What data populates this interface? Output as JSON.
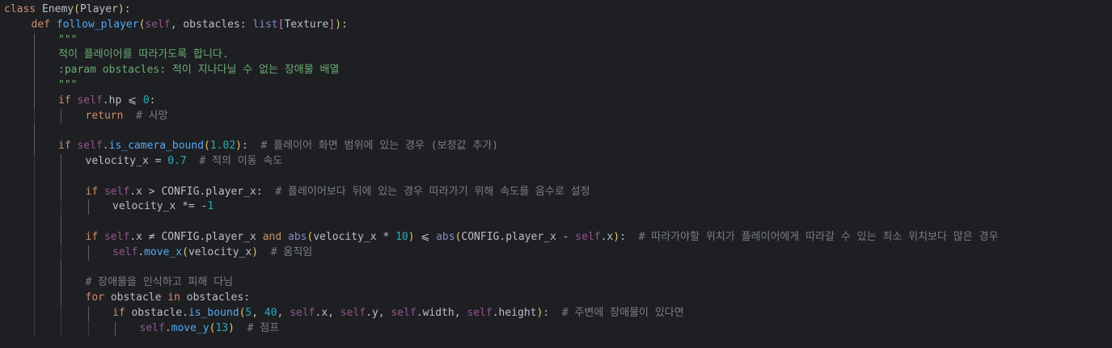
{
  "editor": {
    "language": "python",
    "background": "#1e1f22",
    "colors": {
      "keyword": "#cf8e6d",
      "function": "#56a8f5",
      "builtin": "#8888c6",
      "string": "#6aab73",
      "comment": "#7a7e85",
      "number": "#2aacb8",
      "class_ref": "#bcbec4",
      "self": "#94558d"
    },
    "lines": [
      {
        "indent": 0,
        "tokens": [
          [
            "kw",
            "class "
          ],
          [
            "cls",
            "Enemy"
          ],
          [
            "paren",
            "("
          ],
          [
            "cls",
            "Player"
          ],
          [
            "paren",
            "):"
          ]
        ]
      },
      {
        "indent": 1,
        "tokens": [
          [
            "kw",
            "def "
          ],
          [
            "fn",
            "follow_player"
          ],
          [
            "paren",
            "("
          ],
          [
            "self",
            "self"
          ],
          [
            "txt",
            ", obstacles: "
          ],
          [
            "builtin",
            "list"
          ],
          [
            "bracket",
            "["
          ],
          [
            "cls",
            "Texture"
          ],
          [
            "bracket",
            "]"
          ],
          [
            "paren",
            ")"
          ],
          [
            "txt",
            ":"
          ]
        ]
      },
      {
        "indent": 2,
        "tokens": [
          [
            "str",
            "\"\"\""
          ]
        ]
      },
      {
        "indent": 2,
        "tokens": [
          [
            "str",
            "적이 플레이어를 따라가도록 합니다."
          ]
        ]
      },
      {
        "indent": 2,
        "tokens": [
          [
            "str",
            ":param obstacles: 적이 지나다닐 수 없는 장애물 배열"
          ]
        ]
      },
      {
        "indent": 2,
        "tokens": [
          [
            "str",
            "\"\"\""
          ]
        ]
      },
      {
        "indent": 2,
        "tokens": [
          [
            "kw",
            "if "
          ],
          [
            "self",
            "self"
          ],
          [
            "txt",
            ".hp "
          ],
          [
            "txt",
            "⩽ "
          ],
          [
            "num",
            "0"
          ],
          [
            "txt",
            ":"
          ]
        ]
      },
      {
        "indent": 3,
        "tokens": [
          [
            "kw",
            "return"
          ],
          [
            "txt",
            "  "
          ],
          [
            "cmt",
            "# 사망"
          ]
        ]
      },
      {
        "indent": 0,
        "tokens": []
      },
      {
        "indent": 2,
        "tokens": [
          [
            "kw",
            "if "
          ],
          [
            "self",
            "self"
          ],
          [
            "txt",
            "."
          ],
          [
            "fn",
            "is_camera_bound"
          ],
          [
            "paren",
            "("
          ],
          [
            "num",
            "1.02"
          ],
          [
            "paren",
            ")"
          ],
          [
            "txt",
            ":  "
          ],
          [
            "cmt",
            "# 플레이어 화면 범위에 있는 경우 (보정값 추가)"
          ]
        ]
      },
      {
        "indent": 3,
        "tokens": [
          [
            "txt",
            "velocity_x = "
          ],
          [
            "num",
            "0.7"
          ],
          [
            "txt",
            "  "
          ],
          [
            "cmt",
            "# 적의 이동 속도"
          ]
        ]
      },
      {
        "indent": 0,
        "tokens": []
      },
      {
        "indent": 3,
        "tokens": [
          [
            "kw",
            "if "
          ],
          [
            "self",
            "self"
          ],
          [
            "txt",
            ".x > "
          ],
          [
            "cls",
            "CONFIG"
          ],
          [
            "txt",
            ".player_x:  "
          ],
          [
            "cmt",
            "# 플레이어보다 뒤에 있는 경우 따라가기 위해 속도를 음수로 설정"
          ]
        ]
      },
      {
        "indent": 4,
        "tokens": [
          [
            "txt",
            "velocity_x *= -"
          ],
          [
            "num",
            "1"
          ]
        ]
      },
      {
        "indent": 0,
        "tokens": []
      },
      {
        "indent": 3,
        "tokens": [
          [
            "kw",
            "if "
          ],
          [
            "self",
            "self"
          ],
          [
            "txt",
            ".x ≠ "
          ],
          [
            "cls",
            "CONFIG"
          ],
          [
            "txt",
            ".player_x "
          ],
          [
            "kw",
            "and "
          ],
          [
            "builtin",
            "abs"
          ],
          [
            "paren",
            "("
          ],
          [
            "txt",
            "velocity_x * "
          ],
          [
            "num",
            "10"
          ],
          [
            "paren",
            ")"
          ],
          [
            "txt",
            " ⩽ "
          ],
          [
            "builtin",
            "abs"
          ],
          [
            "paren",
            "("
          ],
          [
            "cls",
            "CONFIG"
          ],
          [
            "txt",
            ".player_x - "
          ],
          [
            "self",
            "self"
          ],
          [
            "txt",
            ".x"
          ],
          [
            "paren",
            ")"
          ],
          [
            "txt",
            ":  "
          ],
          [
            "cmt",
            "# 따라가야할 위치가 플레이어에게 따라갈 수 있는 최소 위치보다 많은 경우"
          ]
        ]
      },
      {
        "indent": 4,
        "tokens": [
          [
            "self",
            "self"
          ],
          [
            "txt",
            "."
          ],
          [
            "fn",
            "move_x"
          ],
          [
            "paren",
            "("
          ],
          [
            "txt",
            "velocity_x"
          ],
          [
            "paren",
            ")"
          ],
          [
            "txt",
            "  "
          ],
          [
            "cmt",
            "# 움직임"
          ]
        ]
      },
      {
        "indent": 0,
        "tokens": []
      },
      {
        "indent": 3,
        "tokens": [
          [
            "cmt",
            "# 장애물을 인식하고 피해 다님"
          ]
        ]
      },
      {
        "indent": 3,
        "tokens": [
          [
            "kw",
            "for "
          ],
          [
            "txt",
            "obstacle "
          ],
          [
            "kw",
            "in "
          ],
          [
            "txt",
            "obstacles:"
          ]
        ]
      },
      {
        "indent": 4,
        "tokens": [
          [
            "kw",
            "if "
          ],
          [
            "txt",
            "obstacle."
          ],
          [
            "fn",
            "is_bound"
          ],
          [
            "paren",
            "("
          ],
          [
            "num",
            "5"
          ],
          [
            "txt",
            ", "
          ],
          [
            "num",
            "40"
          ],
          [
            "txt",
            ", "
          ],
          [
            "self",
            "self"
          ],
          [
            "txt",
            ".x, "
          ],
          [
            "self",
            "self"
          ],
          [
            "txt",
            ".y, "
          ],
          [
            "self",
            "self"
          ],
          [
            "txt",
            ".width, "
          ],
          [
            "self",
            "self"
          ],
          [
            "txt",
            ".height"
          ],
          [
            "paren",
            ")"
          ],
          [
            "txt",
            ":  "
          ],
          [
            "cmt",
            "# 주변에 장애물이 있다면"
          ]
        ]
      },
      {
        "indent": 5,
        "tokens": [
          [
            "self",
            "self"
          ],
          [
            "txt",
            "."
          ],
          [
            "fn",
            "move_y"
          ],
          [
            "paren",
            "("
          ],
          [
            "num",
            "13"
          ],
          [
            "paren",
            ")"
          ],
          [
            "txt",
            "  "
          ],
          [
            "cmt",
            "# 점프"
          ]
        ]
      }
    ]
  }
}
